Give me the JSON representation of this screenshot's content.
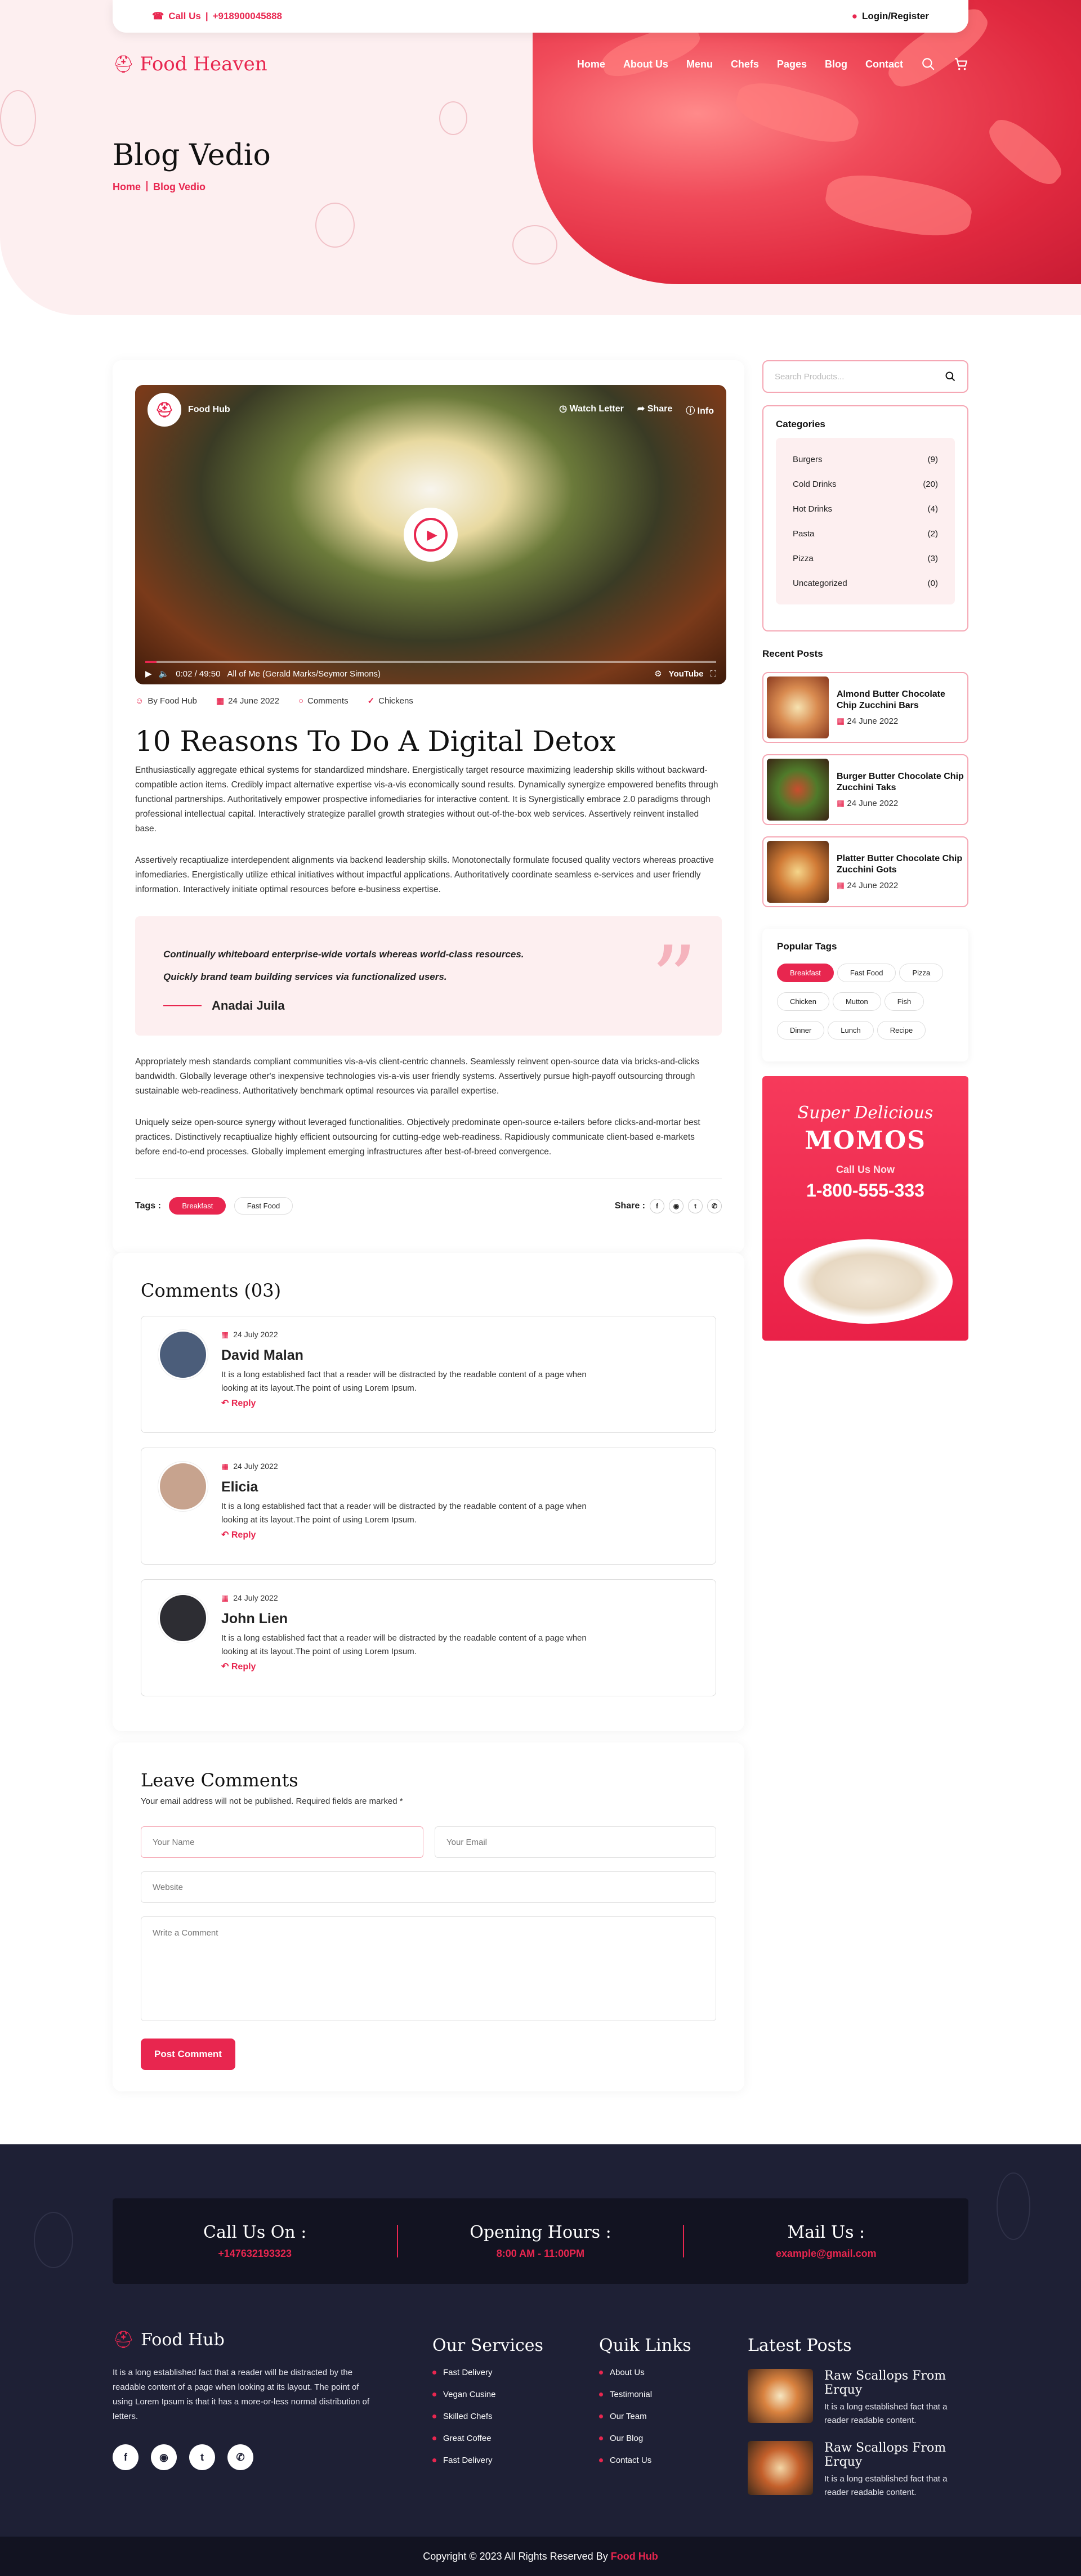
{
  "topbar": {
    "call_label": "Call Us",
    "phone": "+918900045888",
    "login": "Login/Register"
  },
  "brand": {
    "name": "Food Heaven",
    "accent": "#e8264f"
  },
  "nav": {
    "items": [
      "Home",
      "About Us",
      "Menu",
      "Chefs",
      "Pages",
      "Blog",
      "Contact"
    ]
  },
  "hero": {
    "title": "Blog Vedio",
    "crumb_home": "Home",
    "crumb_current": "Blog Vedio"
  },
  "video": {
    "channel": "Food Hub",
    "watch_later": "Watch Letter",
    "share": "Share",
    "info": "Info",
    "time": "0:02 / 49:50",
    "caption": "All of Me (Gerald Marks/Seymor Simons)",
    "youtube": "YouTube"
  },
  "post": {
    "author": "By Food Hub",
    "date": "24 June 2022",
    "comments": "Comments",
    "category": "Chickens",
    "title": "10 Reasons To Do A Digital Detox",
    "p1": "Enthusiastically aggregate ethical systems for standardized mindshare. Energistically target resource maximizing leadership skills without backward-compatible action items. Credibly impact alternative expertise vis-a-vis economically sound results. Dynamically synergize empowered benefits through functional partnerships. Authoritatively empower prospective infomediaries for interactive content. It is Synergistically embrace 2.0 paradigms through professional intellectual capital. Interactively strategize parallel growth strategies without out-of-the-box web services. Assertively reinvent installed base.",
    "p2": "Assertively recaptiualize interdependent alignments via backend leadership skills. Monotonectally formulate focused quality vectors whereas proactive infomediaries. Energistically utilize ethical initiatives without impactful applications. Authoritatively coordinate seamless e-services and user friendly information. Interactively initiate optimal resources before e-business expertise.",
    "quote": "Continually whiteboard enterprise-wide vortals whereas world-class resources. Quickly brand team building services via functionalized users.",
    "quote_author": "Anadai Juila",
    "p3": "Appropriately mesh standards compliant communities vis-a-vis client-centric channels. Seamlessly reinvent open-source data via bricks-and-clicks bandwidth. Globally leverage other's inexpensive technologies vis-a-vis user friendly systems. Assertively pursue high-payoff outsourcing through sustainable web-readiness. Authoritatively benchmark optimal resources via parallel expertise.",
    "p4": "Uniquely seize open-source synergy without leveraged functionalities. Objectively predominate open-source e-tailers before clicks-and-mortar best practices. Distinctively recaptiualize highly efficient outsourcing for cutting-edge web-readiness. Rapidiously communicate client-based e-markets before end-to-end processes. Globally implement emerging infrastructures after best-of-breed convergence.",
    "tags_label": "Tags :",
    "tags": [
      "Breakfast",
      "Fast Food"
    ],
    "share_label": "Share :"
  },
  "comments": {
    "heading": "Comments (03)",
    "items": [
      {
        "date": "24 July 2022",
        "name": "David Malan",
        "text": "It is a long established fact that a reader will be distracted by the readable content of a page when looking at its layout.The point of using Lorem Ipsum.",
        "reply": "Reply"
      },
      {
        "date": "24 July 2022",
        "name": "Elicia",
        "text": "It is a long established fact that a reader will be distracted by the readable content of a page when looking at its layout.The point of using Lorem Ipsum.",
        "reply": "Reply"
      },
      {
        "date": "24 July 2022",
        "name": "John Lien",
        "text": "It is a long established fact that a reader will be distracted by the readable content of a page when looking at its layout.The point of using Lorem Ipsum.",
        "reply": "Reply"
      }
    ]
  },
  "leave": {
    "heading": "Leave Comments",
    "note": "Your email address will not be published. Required fields are marked *",
    "name_ph": "Your Name",
    "email_ph": "Your Email",
    "website_ph": "Website",
    "comment_ph": "Write a Comment",
    "submit": "Post Comment"
  },
  "sidebar": {
    "search_ph": "Search Products...",
    "cat_heading": "Categories",
    "categories": [
      {
        "name": "Burgers",
        "count": "(9)"
      },
      {
        "name": "Cold Drinks",
        "count": "(20)"
      },
      {
        "name": "Hot Drinks",
        "count": "(4)"
      },
      {
        "name": "Pasta",
        "count": "(2)"
      },
      {
        "name": "Pizza",
        "count": "(3)"
      },
      {
        "name": "Uncategorized",
        "count": "(0)"
      }
    ],
    "recent_heading": "Recent Posts",
    "recent": [
      {
        "title": "Almond Butter Chocolate Chip Zucchini Bars",
        "date": "24 June 2022"
      },
      {
        "title": "Burger Butter Chocolate Chip Zucchini Taks",
        "date": "24 June 2022"
      },
      {
        "title": "Platter Butter Chocolate Chip Zucchini Gots",
        "date": "24 June 2022"
      }
    ],
    "tags_heading": "Popular Tags",
    "tags": [
      "Breakfast",
      "Fast Food",
      "Pizza",
      "Chicken",
      "Mutton",
      "Fish",
      "Dinner",
      "Lunch",
      "Recipe"
    ],
    "promo": {
      "script": "Super Delicious",
      "title": "MOMOS",
      "call": "Call Us Now",
      "phone": "1-800-555-333"
    }
  },
  "footer": {
    "call_title": "Call Us On :",
    "call_value": "+147632193323",
    "hours_title": "Opening Hours :",
    "hours_value": "8:00 AM - 11:00PM",
    "mail_title": "Mail Us :",
    "mail_value": "example@gmail.com",
    "brand": "Food Hub",
    "about": "It is a long established fact that a reader will be distracted by the readable content of a page when looking at its layout. The point of using Lorem Ipsum is that it has a more-or-less normal distribution of letters.",
    "services_heading": "Our Services",
    "services": [
      "Fast Delivery",
      "Vegan Cusine",
      "Skilled Chefs",
      "Great Coffee",
      "Fast Delivery"
    ],
    "links_heading": "Quik Links",
    "links": [
      "About Us",
      "Testimonial",
      "Our Team",
      "Our Blog",
      "Contact Us"
    ],
    "latest_heading": "Latest Posts",
    "latest": [
      {
        "title": "Raw Scallops From Erquy",
        "text": "It is a long established fact that a reader readable content."
      },
      {
        "title": "Raw Scallops From Erquy",
        "text": "It is a long established fact that a reader readable content."
      }
    ],
    "copyright": "Copyright © 2023 All Rights Reserved By",
    "copyright_brand": "Food Hub"
  }
}
